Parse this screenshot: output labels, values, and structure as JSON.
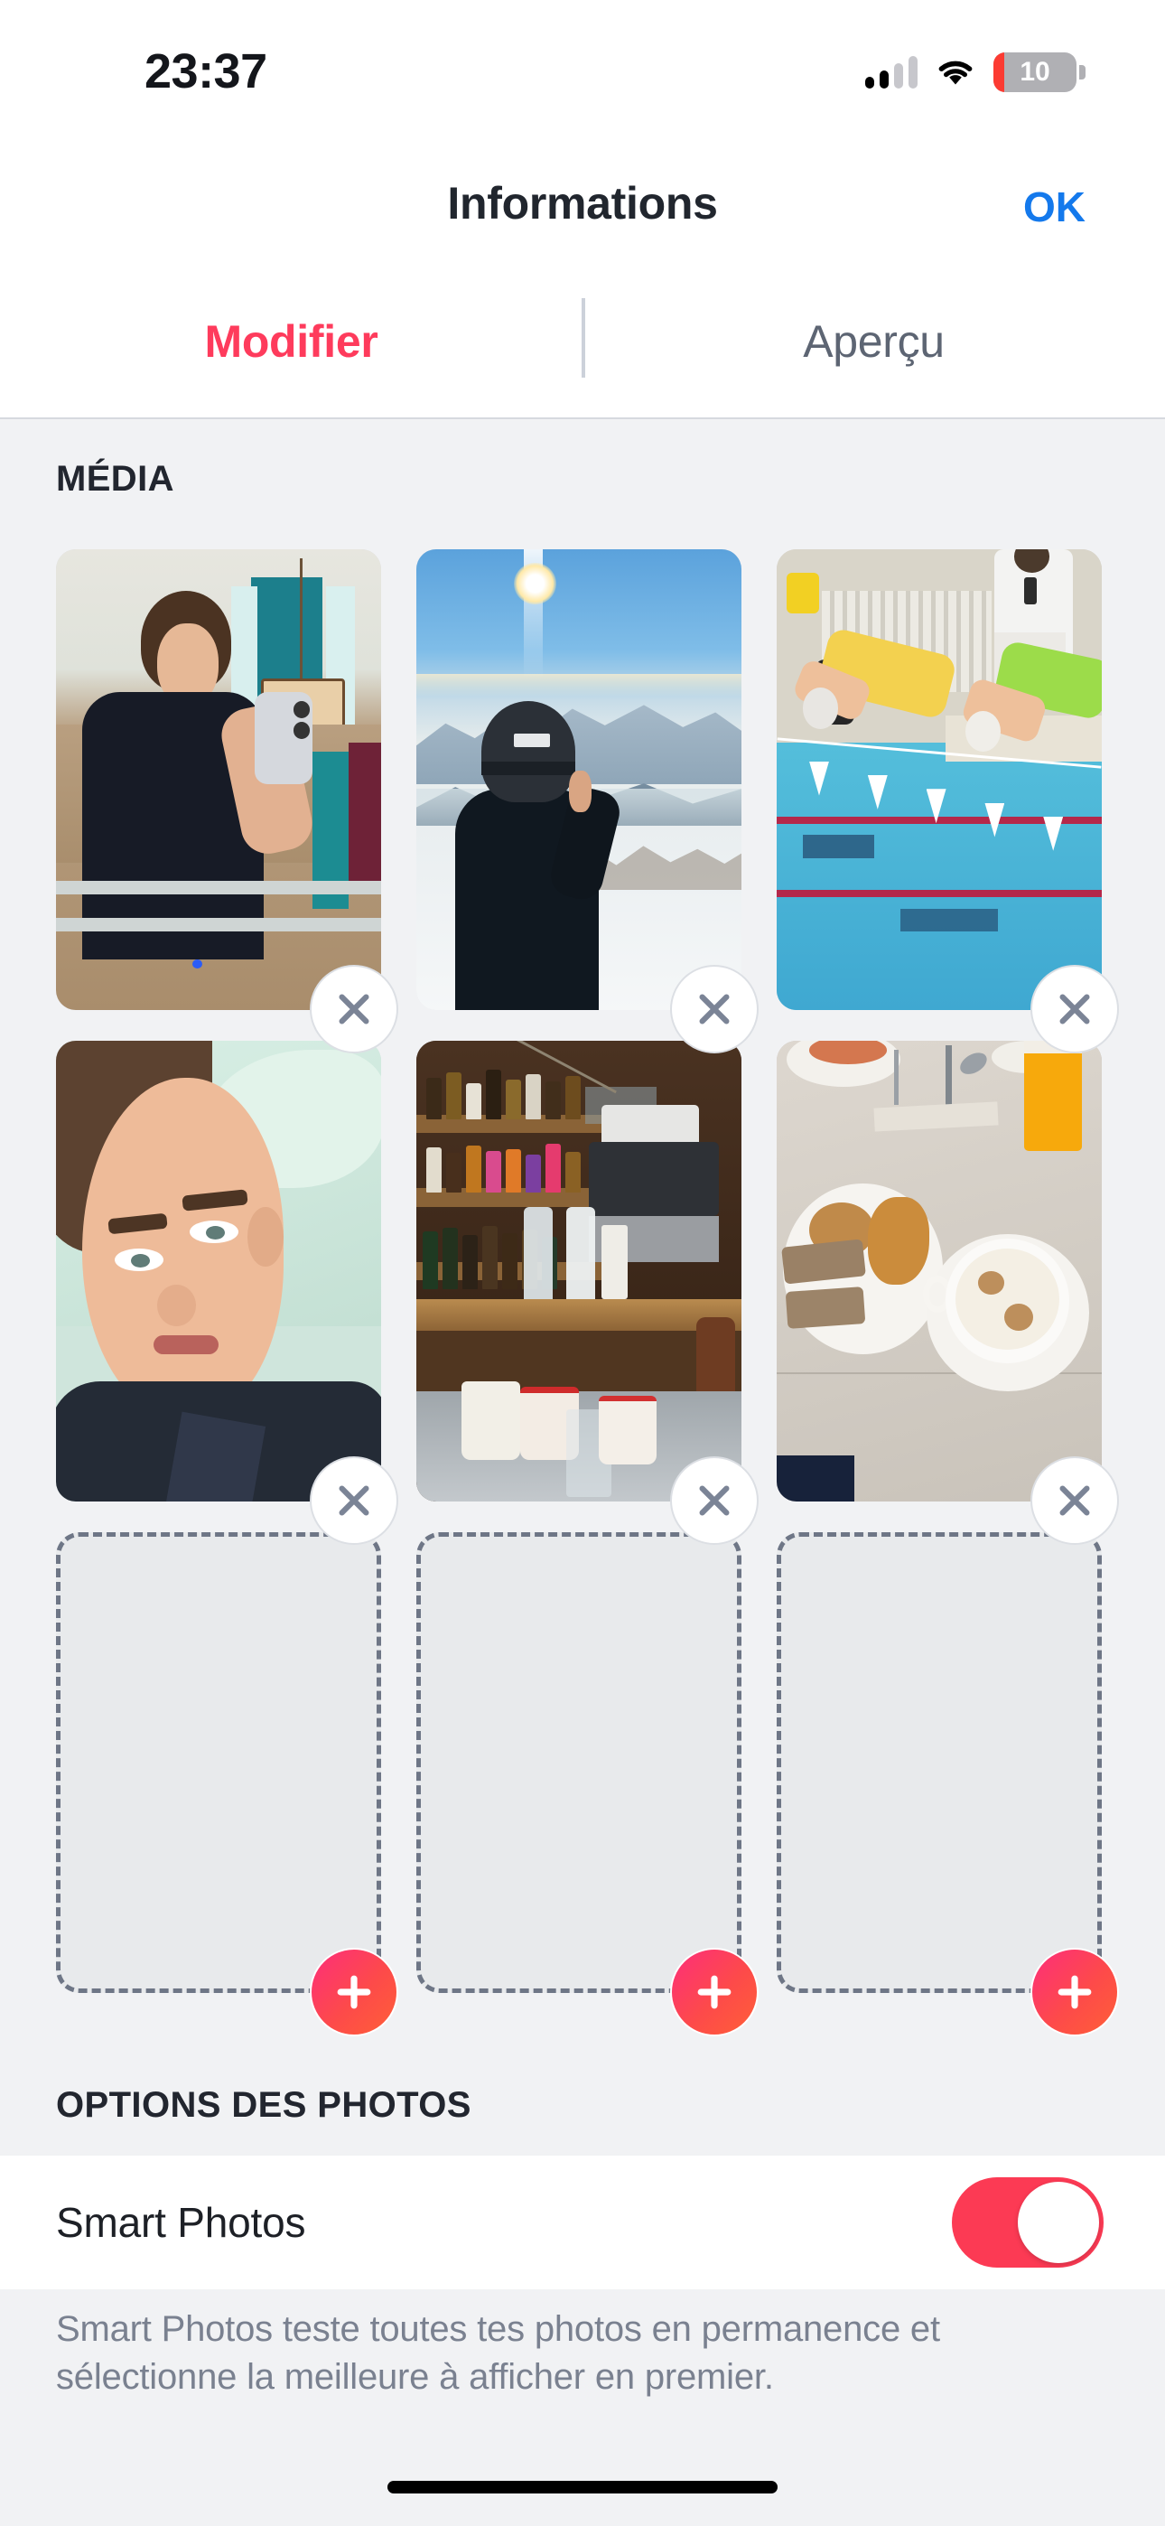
{
  "status_bar": {
    "time": "23:37",
    "battery_level": "10",
    "battery_percent": 10,
    "signal_bars_filled": 2,
    "signal_bars_total": 4,
    "wifi": "wifi-icon",
    "battery_color": "#fc3b32"
  },
  "nav": {
    "title": "Informations",
    "done_label": "OK",
    "done_color": "#1479ec"
  },
  "tabs": [
    {
      "label": "Modifier",
      "active": true,
      "color": "#fe3b5c"
    },
    {
      "label": "Aperçu",
      "active": false,
      "color": "#5d6573"
    }
  ],
  "sections": {
    "media": {
      "header": "MÉDIA"
    },
    "photo_options": {
      "header": "OPTIONS DES PHOTOS"
    }
  },
  "media": {
    "remove_icon": "close-icon",
    "add_icon": "plus-icon",
    "accent_color": "#fe3b5c",
    "photos": [
      {
        "alt": "Selfie miroir salle de bain, polo noir"
      },
      {
        "alt": "Skieur avec casque face aux montagnes enneigées"
      },
      {
        "alt": "Plongeon dans une piscine de compétition"
      },
      {
        "alt": "Selfie allongé sur un oreiller vert d'eau"
      },
      {
        "alt": "Comptoir de bar avec bouteilles et tasses de Noël"
      },
      {
        "alt": "Petit-déjeuner croissant, pain et cappuccino"
      }
    ],
    "empty_slots": 3
  },
  "photo_options": {
    "smart_photos": {
      "label": "Smart Photos",
      "enabled": true,
      "toggle_on_color": "#fc3a54"
    },
    "footer_note": "Smart Photos teste toutes tes photos en permanence et sélectionne la meilleure à afficher en premier."
  },
  "home_indicator": "home-indicator"
}
